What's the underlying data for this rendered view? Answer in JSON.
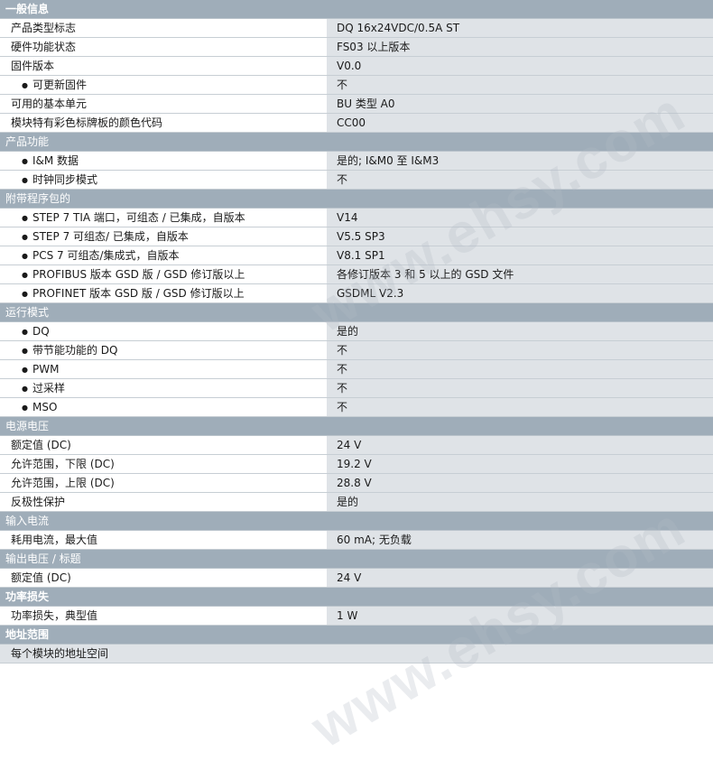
{
  "sections": [
    {
      "title": "一般信息",
      "bold": true,
      "rows": [
        {
          "label": "产品类型标志",
          "value": "DQ 16x24VDC/0.5A ST"
        },
        {
          "label": "硬件功能状态",
          "value": "FS03 以上版本"
        },
        {
          "label": "固件版本",
          "value": "V0.0"
        },
        {
          "label": "可更新固件",
          "value": "不",
          "sub": true
        },
        {
          "label": "可用的基本单元",
          "value": "BU 类型 A0"
        },
        {
          "label": "模块特有彩色标牌板的颜色代码",
          "value": "CC00"
        }
      ]
    },
    {
      "title": "产品功能",
      "bold": false,
      "rows": [
        {
          "label": "I&M 数据",
          "value": "是的; I&M0 至 I&M3",
          "sub": true
        },
        {
          "label": "时钟同步模式",
          "value": "不",
          "sub": true
        }
      ]
    },
    {
      "title": "附带程序包的",
      "bold": false,
      "rows": [
        {
          "label": "STEP 7 TIA 端口，可组态 / 已集成，自版本",
          "value": "V14",
          "sub": true
        },
        {
          "label": "STEP 7 可组态/ 已集成，自版本",
          "value": "V5.5 SP3",
          "sub": true
        },
        {
          "label": "PCS 7 可组态/集成式，自版本",
          "value": "V8.1 SP1",
          "sub": true
        },
        {
          "label": "PROFIBUS 版本 GSD 版 / GSD 修订版以上",
          "value": "各修订版本 3 和 5 以上的 GSD 文件",
          "sub": true
        },
        {
          "label": "PROFINET 版本 GSD 版 / GSD 修订版以上",
          "value": "GSDML V2.3",
          "sub": true
        }
      ]
    },
    {
      "title": "运行模式",
      "bold": false,
      "rows": [
        {
          "label": "DQ",
          "value": "是的",
          "sub": true
        },
        {
          "label": "带节能功能的 DQ",
          "value": "不",
          "sub": true
        },
        {
          "label": "PWM",
          "value": "不",
          "sub": true
        },
        {
          "label": "过采样",
          "value": "不",
          "sub": true
        },
        {
          "label": "MSO",
          "value": "不",
          "sub": true
        }
      ]
    },
    {
      "title": "电源电压",
      "bold": false,
      "rows": [
        {
          "label": "额定值 (DC)",
          "value": "24 V"
        },
        {
          "label": "允许范围，下限 (DC)",
          "value": "19.2 V"
        },
        {
          "label": "允许范围，上限 (DC)",
          "value": "28.8 V"
        },
        {
          "label": "反极性保护",
          "value": "是的"
        }
      ]
    },
    {
      "title": "输入电流",
      "bold": false,
      "rows": [
        {
          "label": "耗用电流，最大值",
          "value": "60 mA; 无负载"
        }
      ]
    },
    {
      "title": "输出电压 / 标题",
      "bold": false,
      "rows": [
        {
          "label": "额定值 (DC)",
          "value": "24 V"
        }
      ]
    },
    {
      "title": "功率损失",
      "bold": true,
      "rows": [
        {
          "label": "功率损失，典型值",
          "value": "1 W"
        }
      ]
    },
    {
      "title": "地址范围",
      "bold": true,
      "rows": [
        {
          "label": "每个模块的地址空间",
          "value": "",
          "full": true
        }
      ]
    }
  ],
  "watermark": {
    "text": "www.ehsy.com"
  }
}
